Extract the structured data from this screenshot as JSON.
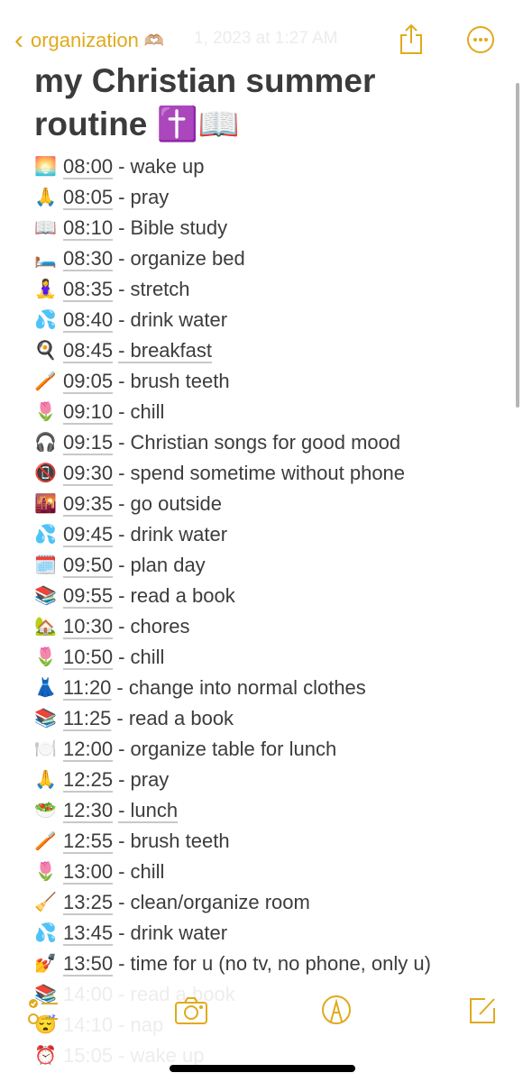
{
  "nav": {
    "back_label": "organization",
    "back_emoji": "🫶🏼",
    "date": "1, 2023 at 1:27 AM",
    "icons": [
      "chevron-left-icon",
      "share-icon",
      "more-icon"
    ]
  },
  "note": {
    "title": "my Christian summer routine ✝️📖",
    "items": [
      {
        "emoji": "🌅",
        "time": "08:00",
        "task": "- wake up"
      },
      {
        "emoji": "🙏",
        "time": "08:05",
        "task": "- pray"
      },
      {
        "emoji": "📖",
        "time": "08:10",
        "task": "- Bible study"
      },
      {
        "emoji": "🛏️",
        "time": "08:30",
        "task": "- organize bed"
      },
      {
        "emoji": "🧘‍♀️",
        "time": "08:35",
        "task": "- stretch"
      },
      {
        "emoji": "💦",
        "time": "08:40",
        "task": "- drink water"
      },
      {
        "emoji": "🍳",
        "time": "08:45",
        "task": "- breakfast",
        "underline": true
      },
      {
        "emoji": "🪥",
        "time": "09:05",
        "task": "- brush teeth"
      },
      {
        "emoji": "🌷",
        "time": "09:10",
        "task": "- chill"
      },
      {
        "emoji": "🎧",
        "time": "09:15",
        "task": "- Christian songs for good mood"
      },
      {
        "emoji": "📵",
        "time": "09:30",
        "task": "- spend sometime without phone"
      },
      {
        "emoji": "🌇",
        "time": "09:35",
        "task": "- go outside"
      },
      {
        "emoji": "💦",
        "time": "09:45",
        "task": "- drink water"
      },
      {
        "emoji": "🗓️",
        "time": "09:50",
        "task": "- plan day"
      },
      {
        "emoji": "📚",
        "time": "09:55",
        "task": "- read a book"
      },
      {
        "emoji": "🏡",
        "time": "10:30",
        "task": "- chores"
      },
      {
        "emoji": "🌷",
        "time": "10:50",
        "task": "- chill"
      },
      {
        "emoji": "👗",
        "time": "11:20",
        "task": "- change into normal clothes"
      },
      {
        "emoji": "📚",
        "time": "11:25",
        "task": "- read a book"
      },
      {
        "emoji": "🍽️",
        "time": "12:00",
        "task": "- organize table for lunch"
      },
      {
        "emoji": "🙏",
        "time": "12:25",
        "task": "- pray"
      },
      {
        "emoji": "🥗",
        "time": "12:30",
        "task": "- lunch",
        "underline": true
      },
      {
        "emoji": "🪥",
        "time": "12:55",
        "task": "- brush teeth"
      },
      {
        "emoji": "🌷",
        "time": "13:00",
        "task": "- chill"
      },
      {
        "emoji": "🧹",
        "time": "13:25",
        "task": "- clean/organize room"
      },
      {
        "emoji": "💦",
        "time": "13:45",
        "task": "- drink water"
      },
      {
        "emoji": "💅",
        "time": "13:50",
        "task": "- time for u (no tv, no phone, only u)"
      },
      {
        "emoji": "📚",
        "time": "14:00",
        "task": "- read a book",
        "faded": true
      },
      {
        "emoji": "😴",
        "time": "14:10",
        "task": "- nap",
        "faded": true
      },
      {
        "emoji": "⏰",
        "time": "15:05",
        "task": "- wake up",
        "faded": true
      }
    ]
  },
  "toolbar": {
    "icons": [
      "checklist-icon",
      "camera-icon",
      "markup-icon",
      "compose-icon"
    ]
  },
  "colors": {
    "accent": "#e0aa1c",
    "text": "#3c3c3c"
  }
}
